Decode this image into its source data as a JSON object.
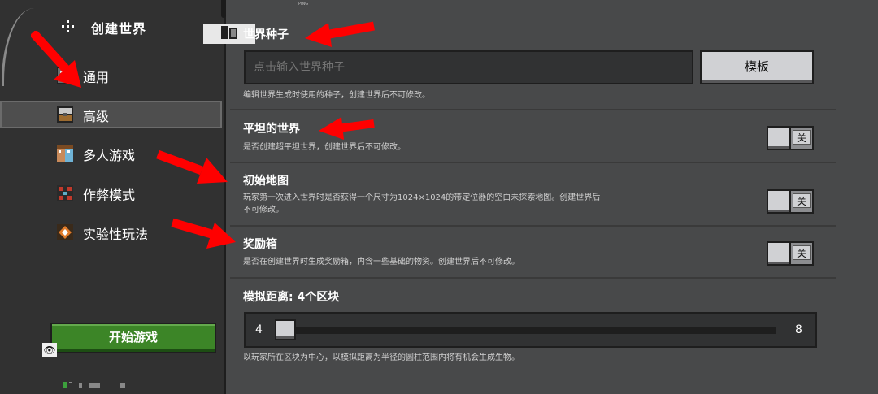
{
  "sidebar": {
    "title": "创建世界",
    "items": [
      {
        "label": "通用"
      },
      {
        "label": "高级"
      },
      {
        "label": "多人游戏"
      },
      {
        "label": "作弊模式"
      },
      {
        "label": "实验性玩法"
      }
    ],
    "selected_index": 1,
    "start_button": "开始游戏"
  },
  "main": {
    "seed": {
      "title": "世界种子",
      "placeholder": "点击输入世界种子",
      "template_button": "模板",
      "description": "编辑世界生成时使用的种子，创建世界后不可修改。"
    },
    "flat_world": {
      "title": "平坦的世界",
      "description": "是否创建超平坦世界，创建世界后不可修改。",
      "toggle_label": "关"
    },
    "starting_map": {
      "title": "初始地图",
      "description_line1": "玩家第一次进入世界时是否获得一个尺寸为1024×1024的带定位器的空白未探索地图。创建世界后",
      "description_line2": "不可修改。",
      "toggle_label": "关"
    },
    "bonus_chest": {
      "title": "奖励箱",
      "description": "是否在创建世界时生成奖励箱，内含一些基础的物资。创建世界后不可修改。",
      "toggle_label": "关"
    },
    "simulation_distance": {
      "title": "模拟距离: 4个区块",
      "min": "4",
      "max": "8",
      "value": 4,
      "description": "以玩家所在区块为中心，以模拟距离为半径的圆柱范围内将有机会生成生物。"
    }
  },
  "colors": {
    "panel": "#48494a",
    "sidebar": "#313131",
    "start_button": "#3c8527",
    "annotation_arrow": "#ff0000"
  }
}
